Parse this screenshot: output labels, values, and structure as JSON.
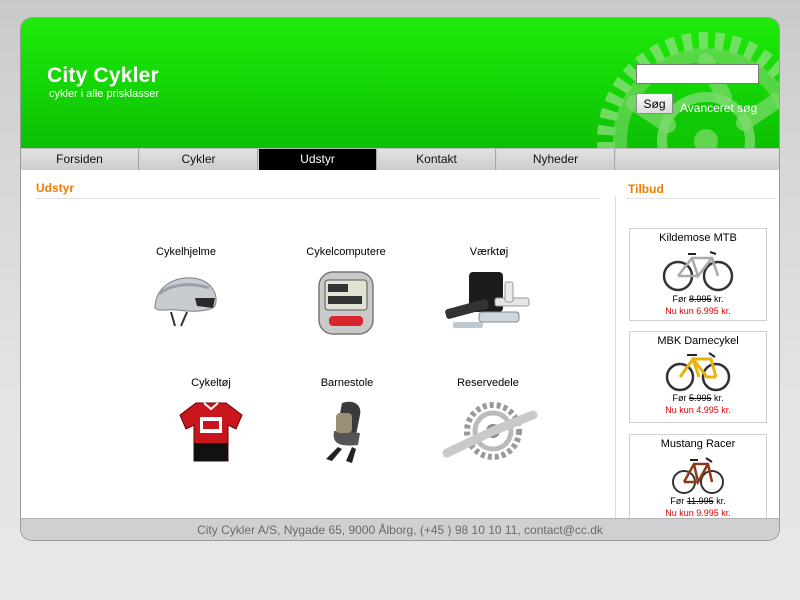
{
  "site": {
    "title": "City Cykler",
    "tagline": "cykler i alle prisklasser"
  },
  "search": {
    "placeholder": "",
    "value": "",
    "button_label": "Søg",
    "advanced_label": "Avanceret søg"
  },
  "nav": {
    "items": [
      {
        "label": "Forsiden"
      },
      {
        "label": "Cykler"
      },
      {
        "label": "Udstyr",
        "active": true
      },
      {
        "label": "Kontakt"
      },
      {
        "label": "Nyheder"
      }
    ]
  },
  "main": {
    "title": "Udstyr",
    "products": [
      {
        "label": "Cykelhjelme",
        "icon": "helmet-icon"
      },
      {
        "label": "Cykelcomputere",
        "icon": "bike-computer-icon"
      },
      {
        "label": "Værktøj",
        "icon": "tool-kit-icon"
      },
      {
        "label": "Cykeltøj",
        "icon": "jersey-icon"
      },
      {
        "label": "Barnestole",
        "icon": "child-seat-icon"
      },
      {
        "label": "Reservedele",
        "icon": "crankset-icon"
      }
    ]
  },
  "offers": {
    "title": "Tilbud",
    "items": [
      {
        "name": "Kildemose MTB",
        "old_prefix": "Før",
        "old_price": "8.995",
        "old_suffix": "kr.",
        "new_price": "Nu kun 6.995 kr.",
        "icon": "mountain-bike-icon"
      },
      {
        "name": "MBK Damecykel",
        "old_prefix": "Før",
        "old_price": "5.995",
        "old_suffix": "kr.",
        "new_price": "Nu kun 4.995 kr.",
        "icon": "city-bike-icon"
      },
      {
        "name": "Mustang Racer",
        "old_prefix": "Før",
        "old_price": "11.995",
        "old_suffix": "kr.",
        "new_price": "Nu kun 9.995 kr.",
        "icon": "racing-bike-icon"
      }
    ]
  },
  "footer": {
    "text": "City Cykler A/S, Nygade 65, 9000 Ålborg, (+45 ) 98 10 10 11, contact@cc.dk"
  },
  "colors": {
    "header_green": "#14d406",
    "accent_orange": "#f07c00",
    "price_red": "#e00000",
    "nav_active": "#000000"
  }
}
